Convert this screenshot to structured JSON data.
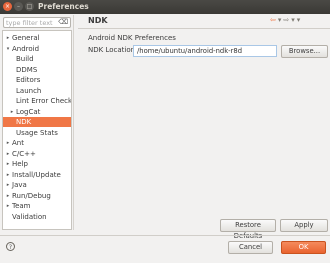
{
  "window": {
    "title": "Preferences",
    "close_glyph": "×",
    "minimize_glyph": "–",
    "maximize_glyph": "□"
  },
  "filter": {
    "placeholder": "type filter text",
    "clear_glyph": "⌫"
  },
  "tree": {
    "items": [
      {
        "label": "General",
        "arrow": "▸"
      },
      {
        "label": "Android",
        "arrow": "▾"
      },
      {
        "label": "Build",
        "arrow": ""
      },
      {
        "label": "DDMS",
        "arrow": ""
      },
      {
        "label": "Editors",
        "arrow": ""
      },
      {
        "label": "Launch",
        "arrow": ""
      },
      {
        "label": "Lint Error Checking",
        "arrow": ""
      },
      {
        "label": "LogCat",
        "arrow": "▸"
      },
      {
        "label": "NDK",
        "arrow": ""
      },
      {
        "label": "Usage Stats",
        "arrow": ""
      },
      {
        "label": "Ant",
        "arrow": "▸"
      },
      {
        "label": "C/C++",
        "arrow": "▸"
      },
      {
        "label": "Help",
        "arrow": "▸"
      },
      {
        "label": "Install/Update",
        "arrow": "▸"
      },
      {
        "label": "Java",
        "arrow": "▸"
      },
      {
        "label": "Run/Debug",
        "arrow": "▸"
      },
      {
        "label": "Team",
        "arrow": "▸"
      },
      {
        "label": "Validation",
        "arrow": ""
      }
    ],
    "selected": "NDK"
  },
  "pane": {
    "title": "NDK",
    "back_glyph": "⇦",
    "forward_glyph": "⇨",
    "menu_glyph": "▾",
    "section_label": "Android NDK Preferences",
    "ndk_location_label": "NDK Location",
    "ndk_location_value": "/home/ubuntu/android-ndk-r8d",
    "browse_label": "Browse...",
    "restore_label": "Restore Defaults",
    "apply_label": "Apply"
  },
  "footer": {
    "help_glyph": "?",
    "cancel_label": "Cancel",
    "ok_label": "OK"
  },
  "colors": {
    "accent": "#f07746",
    "titlebar": "#3c3b37"
  }
}
